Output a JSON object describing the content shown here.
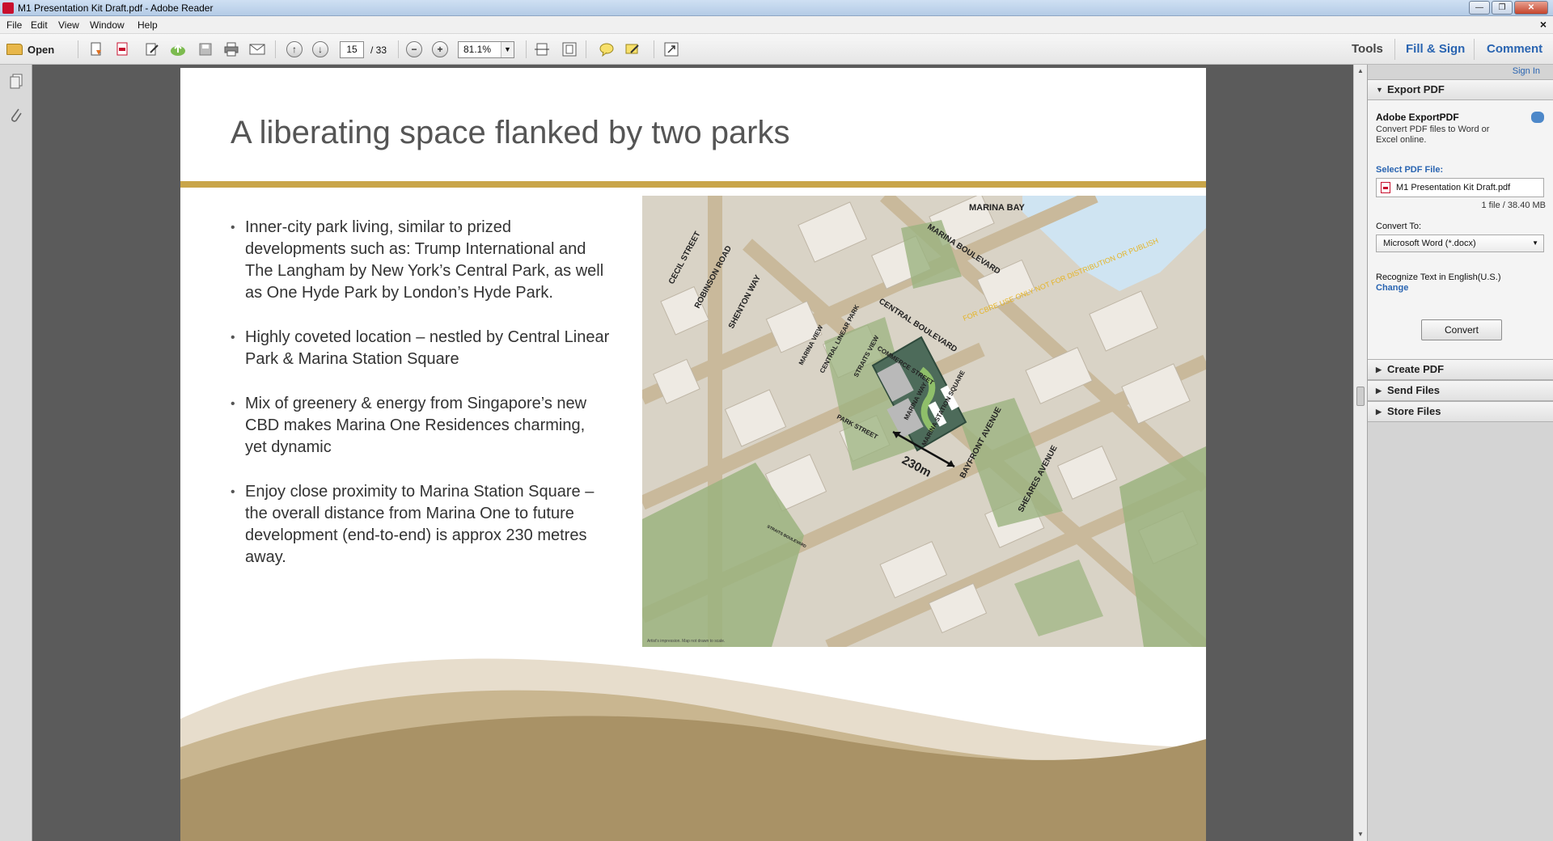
{
  "window": {
    "title": "M1 Presentation Kit Draft.pdf - Adobe Reader",
    "controls": {
      "minimize": "—",
      "maximize": "❐",
      "close": "✕"
    }
  },
  "menu": {
    "items": [
      "File",
      "Edit",
      "View",
      "Window",
      "Help"
    ],
    "close_doc": "×"
  },
  "toolbar": {
    "open_label": "Open",
    "page_current": "15",
    "page_total": "/ 33",
    "zoom": "81.1%",
    "tabs": {
      "tools": "Tools",
      "fill_sign": "Fill & Sign",
      "comment": "Comment"
    }
  },
  "slide": {
    "title": "A liberating space flanked by two parks",
    "bullets": [
      "Inner-city park living, similar to prized developments such as: Trump International and The Langham by New York’s Central Park, as well as One Hyde Park by London’s Hyde Park.",
      "Highly coveted location – nestled by Central Linear Park & Marina Station Square",
      "Mix of greenery & energy from Singapore’s new CBD makes Marina One Residences charming, yet dynamic",
      "Enjoy close proximity to Marina Station Square – the overall distance from Marina One to future development (end-to-end) is approx 230 metres away."
    ],
    "map": {
      "labels": {
        "marina_bay": "MARINA BAY",
        "marina_boulevard": "MARINA BOULEVARD",
        "central_boulevard": "CENTRAL BOULEVARD",
        "cecil_street": "CECIL STREET",
        "robinson_road": "ROBINSON ROAD",
        "shenton_way": "SHENTON WAY",
        "marina_view": "MARINA VIEW",
        "central_linear_park": "CENTRAL LINEAR PARK",
        "straits_view": "STRAITS VIEW",
        "commerce_street": "COMMERCE STREET",
        "marina_way": "MARINA WAY",
        "park_street": "PARK STREET",
        "marina_station_square": "MARINA STATION SQUARE",
        "bayfront_avenue": "BAYFRONT AVENUE",
        "sheares_avenue": "SHEARES AVENUE",
        "distance": "230m",
        "watermark": "FOR CBRE USE ONLY NOT FOR DISTRIBUTION OR PUBLISH",
        "impression_note": "Artist's impression. Map not drawn to scale.",
        "straits_boulevard": "STRAITS BOULEVARD"
      }
    }
  },
  "task_pane": {
    "sign_in": "Sign In",
    "export_header": "Export PDF",
    "export_title": "Adobe ExportPDF",
    "export_desc": "Convert PDF files to Word or Excel online.",
    "select_label": "Select PDF File:",
    "file_name": "M1 Presentation Kit Draft.pdf",
    "file_size": "1 file / 38.40 MB",
    "convert_to_label": "Convert To:",
    "convert_to_value": "Microsoft Word (*.docx)",
    "recognize_text": "Recognize Text in English(U.S.)",
    "change_link": "Change",
    "convert_button": "Convert",
    "sections": [
      "Create PDF",
      "Send Files",
      "Store Files"
    ]
  }
}
